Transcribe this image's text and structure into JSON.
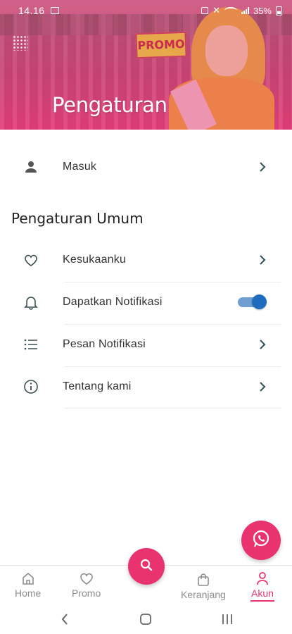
{
  "status_bar": {
    "time": "14.16",
    "battery": "35%"
  },
  "header": {
    "title": "Pengaturan",
    "banner_sign": "PROMO"
  },
  "account_row": {
    "label": "Masuk",
    "icon": "person-icon"
  },
  "general_settings": {
    "section_title": "Pengaturan Umum",
    "items": [
      {
        "label": "Kesukaanku",
        "icon": "heart-icon",
        "control": "chevron"
      },
      {
        "label": "Dapatkan Notifikasi",
        "icon": "bell-icon",
        "control": "toggle",
        "toggle_on": true
      },
      {
        "label": "Pesan Notifikasi",
        "icon": "list-icon",
        "control": "chevron"
      },
      {
        "label": "Tentang kami",
        "icon": "info-icon",
        "control": "chevron"
      }
    ]
  },
  "bottom_nav": {
    "items": [
      {
        "label": "Home",
        "icon": "home-icon",
        "active": false
      },
      {
        "label": "Promo",
        "icon": "heart-icon",
        "active": false
      },
      {
        "label": "Keranjang",
        "icon": "cart-icon",
        "active": false
      },
      {
        "label": "Akun",
        "icon": "person-icon",
        "active": true
      }
    ],
    "center_button_icon": "search-icon"
  },
  "fab": {
    "icon": "whatsapp-icon"
  },
  "colors": {
    "accent": "#e8336e",
    "toggle_on": "#1e6dbd",
    "text": "#333333",
    "icon": "#3d4f52"
  }
}
